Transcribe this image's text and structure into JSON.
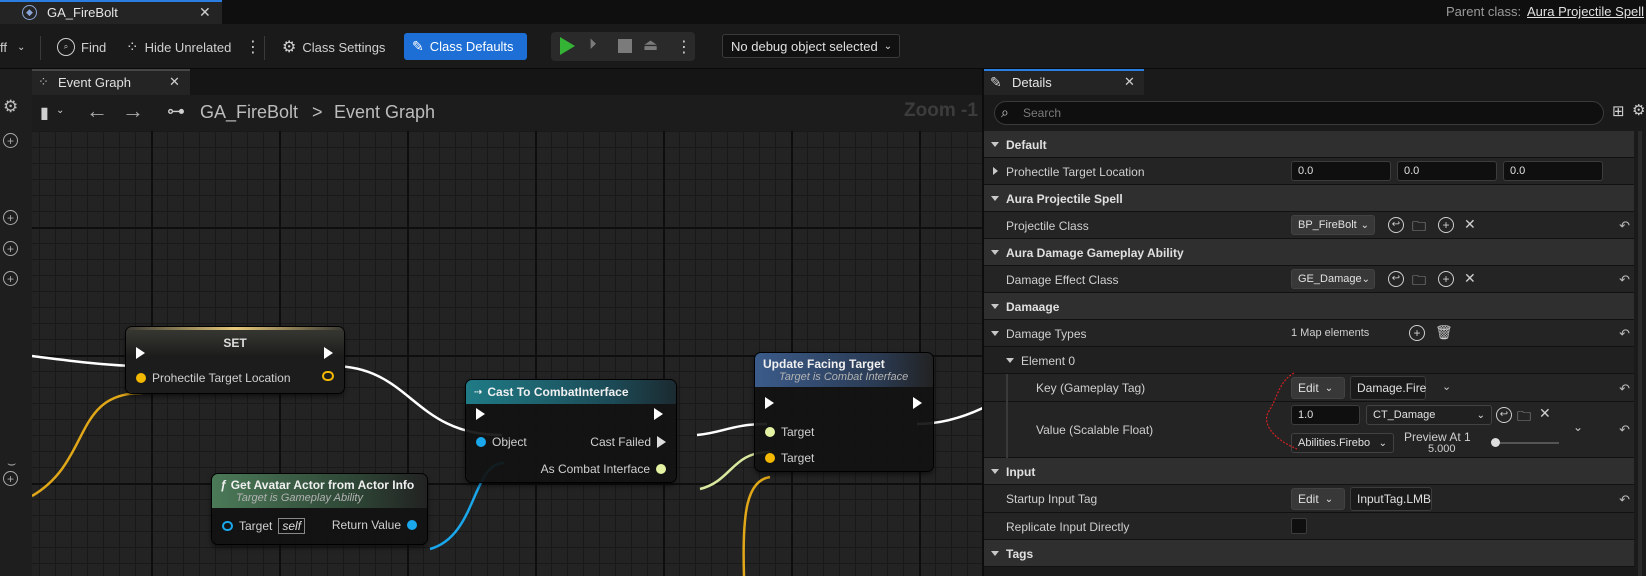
{
  "window": {
    "tab_title": "GA_FireBolt",
    "parent_class_label": "Parent class:",
    "parent_class_value": "Aura Projectile Spell"
  },
  "toolbar": {
    "cut_text": "ff",
    "find": "Find",
    "hide_unrelated": "Hide Unrelated",
    "class_settings": "Class Settings",
    "class_defaults": "Class Defaults",
    "debug_object": "No debug object selected"
  },
  "graph": {
    "tab_label": "Event Graph",
    "breadcrumb_root": "GA_FireBolt",
    "breadcrumb_sep": ">",
    "breadcrumb_leaf": "Event Graph",
    "zoom": "Zoom -1",
    "nodes": {
      "set": {
        "title": "SET",
        "pin": "Prohectile Target Location"
      },
      "cast": {
        "title": "Cast To CombatInterface",
        "object": "Object",
        "cast_failed": "Cast Failed",
        "as_combat": "As Combat Interface"
      },
      "update": {
        "title": "Update Facing Target",
        "subtitle": "Target is Combat Interface",
        "target1": "Target",
        "target2": "Target"
      },
      "avatar": {
        "title": "Get Avatar Actor from Actor Info",
        "subtitle": "Target is Gameplay Ability",
        "target": "Target",
        "target_value": "self",
        "return_value": "Return Value"
      }
    }
  },
  "details": {
    "tab_label": "Details",
    "search_placeholder": "Search",
    "sections": {
      "default": "Default",
      "aura_projectile": "Aura Projectile Spell",
      "aura_damage": "Aura Damage Gameplay Ability",
      "damaage": "Damaage",
      "input": "Input",
      "tags": "Tags"
    },
    "props": {
      "target_location": {
        "label": "Prohectile Target Location",
        "x": "0.0",
        "y": "0.0",
        "z": "0.0"
      },
      "projectile_class": {
        "label": "Projectile Class",
        "value": "BP_FireBolt"
      },
      "damage_effect": {
        "label": "Damage Effect Class",
        "value": "GE_Damage"
      },
      "damage_types": {
        "label": "Damage Types",
        "value": "1 Map elements"
      },
      "element0": {
        "label": "Element 0"
      },
      "key": {
        "label": "Key (Gameplay Tag)",
        "edit": "Edit",
        "value": "Damage.Fire"
      },
      "value": {
        "label": "Value (Scalable Float)",
        "number": "1.0",
        "curve_table": "CT_Damage",
        "row": "Abilities.Firebo",
        "preview_label": "Preview At 1",
        "preview_value": "5.000"
      },
      "startup_input": {
        "label": "Startup Input Tag",
        "edit": "Edit",
        "value": "InputTag.LMB"
      },
      "replicate": {
        "label": "Replicate Input Directly"
      }
    }
  },
  "colors": {
    "accent": "#2a7de1",
    "exec": "#ffffff",
    "vector_pin": "#f5b800",
    "object_pin": "#1aa7ec",
    "interface_pin": "#e3f3a3",
    "annotation": "#d42020"
  }
}
